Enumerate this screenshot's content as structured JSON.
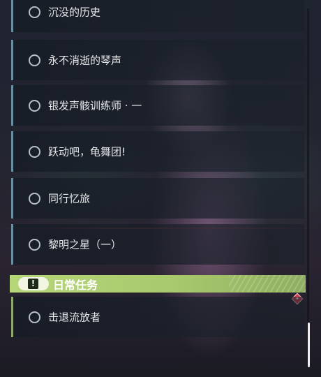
{
  "quests": [
    {
      "label": "沉没的历史"
    },
    {
      "label": "永不消逝的琴声"
    },
    {
      "label": "银发声骸训练师 · 一"
    },
    {
      "label": "跃动吧，龟舞团!"
    },
    {
      "label": "同行忆旅"
    },
    {
      "label": "黎明之星（一）"
    }
  ],
  "daily_section": {
    "title": "日常任务",
    "icon_glyph": "!",
    "icon": "alert-icon",
    "tag_text": "",
    "accent_color": "#b7d67a",
    "quests": [
      {
        "label": "击退流放者"
      }
    ],
    "badge_icon": "diamond-alert-icon"
  },
  "colors": {
    "quest_accent": "#6b8ea0",
    "daily_accent": "#8ea86e",
    "badge": "#d9414c"
  }
}
